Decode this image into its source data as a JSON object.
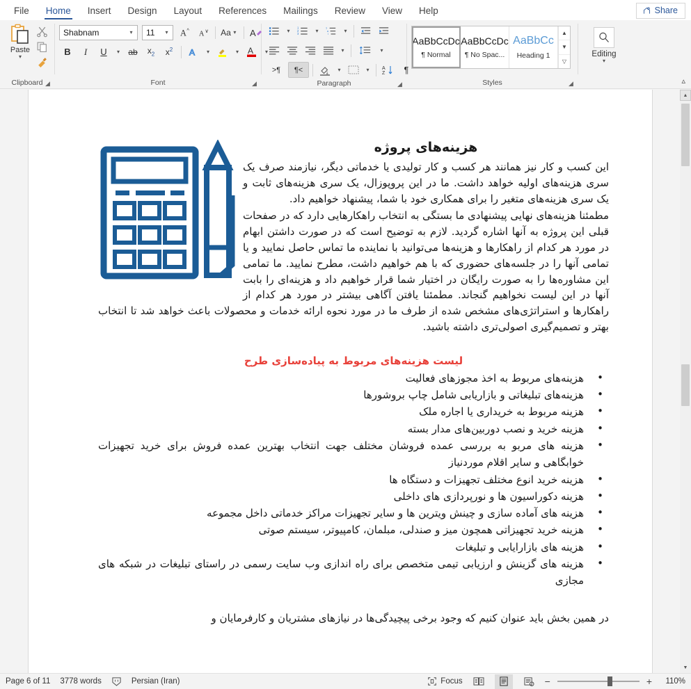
{
  "titlebar": {
    "share_label": "Share",
    "share_icon": "share-person-icon"
  },
  "tabs": [
    {
      "label": "File",
      "active": false
    },
    {
      "label": "Home",
      "active": true
    },
    {
      "label": "Insert",
      "active": false
    },
    {
      "label": "Design",
      "active": false
    },
    {
      "label": "Layout",
      "active": false
    },
    {
      "label": "References",
      "active": false
    },
    {
      "label": "Mailings",
      "active": false
    },
    {
      "label": "Review",
      "active": false
    },
    {
      "label": "View",
      "active": false
    },
    {
      "label": "Help",
      "active": false
    }
  ],
  "ribbon": {
    "clipboard": {
      "group_label": "Clipboard",
      "paste_label": "Paste",
      "paste_icon": "clipboard-paste-icon",
      "cut_icon": "scissors-icon",
      "copy_icon": "copy-icon",
      "format_painter_icon": "format-painter-icon",
      "dialog_launcher_icon": "dialog-launcher-icon"
    },
    "font": {
      "group_label": "Font",
      "font_name": "Shabnam",
      "font_size": "11",
      "grow_font_icon": "grow-font-icon",
      "shrink_font_icon": "shrink-font-icon",
      "change_case_icon": "change-case-icon",
      "clear_formatting_icon": "clear-formatting-icon",
      "bold_label": "B",
      "italic_label": "I",
      "underline_label": "U",
      "strikethrough_icon": "strikethrough-icon",
      "subscript_label": "x",
      "superscript_label": "x",
      "text_effects_icon": "text-effects-icon",
      "highlight_icon": "text-highlight-icon",
      "font_color_icon": "font-color-icon",
      "highlight_color": "#ffff00",
      "font_color": "#e00000",
      "dialog_launcher_icon": "dialog-launcher-icon"
    },
    "paragraph": {
      "group_label": "Paragraph",
      "bullets_icon": "bullets-icon",
      "numbering_icon": "numbering-icon",
      "multilevel_icon": "multilevel-list-icon",
      "decrease_indent_icon": "decrease-indent-icon",
      "increase_indent_icon": "increase-indent-icon",
      "align_left_icon": "align-left-icon",
      "align_center_icon": "align-center-icon",
      "align_right_icon": "align-right-icon",
      "justify_icon": "justify-icon",
      "line_spacing_icon": "line-spacing-icon",
      "ltr_icon": "left-to-right-icon",
      "rtl_icon": "right-to-left-icon",
      "shading_icon": "shading-icon",
      "borders_icon": "borders-icon",
      "sort_icon": "sort-icon",
      "show_marks_icon": "show-formatting-marks-icon",
      "dialog_launcher_icon": "dialog-launcher-icon"
    },
    "styles": {
      "group_label": "Styles",
      "items": [
        {
          "preview": "AaBbCcDc",
          "name": "¶ Normal",
          "selected": true
        },
        {
          "preview": "AaBbCcDc",
          "name": "¶ No Spac...",
          "selected": false
        },
        {
          "preview": "AaBbCc",
          "name": "Heading 1",
          "selected": false
        }
      ],
      "scroll_up_icon": "chevron-up-icon",
      "scroll_down_icon": "chevron-down-icon",
      "more_icon": "styles-more-icon",
      "dialog_launcher_icon": "dialog-launcher-icon"
    },
    "editing": {
      "group_label": "Editing",
      "button_label": "Editing",
      "icon": "magnifier-icon",
      "caret_icon": "chevron-down-icon"
    },
    "collapse_icon": "collapse-ribbon-icon"
  },
  "document": {
    "heading": "هزینه‌های پروژه",
    "paragraph1": "این کسب و کار نیز همانند هر کسب و کار تولیدی یا خدماتی دیگر، نیازمند صرف یک سری هزینه‌های اولیه خواهد داشت. ما در این پروپوزال، یک سری هزینه‌های ثابت و یک سری هزینه‌های متغیر را برای همکاری خود با شما، پیشنهاد خواهیم داد.",
    "paragraph2": "مطمئنا هزینه‌های نهایی پیشنهادی ما بستگی به انتخاب راهکارهایی دارد که در صفحات قبلی این پروژه به آنها اشاره گردید. لازم به توضیح است که در صورت داشتن ابهام در مورد هر کدام از راهکارها و هزینه‌ها می‌توانید با نماینده ما تماس حاصل نمایید و یا تمامی آنها را در جلسه‌های حضوری که با هم خواهیم داشت، مطرح نمایید. ما تمامی این مشاوره‌ها را به صورت رایگان در اختیار شما قرار خواهیم داد و هزینه‌ای را بابت آنها در این لیست نخواهیم گنجاند. مطمئنا یافتن آگاهی بیشتر در مورد هر کدام از راهکارها و استراتژی‌های مشخص شده از طرف ما در مورد نحوه ارائه خدمات و محصولات باعث خواهد شد تا انتخاب بهتر و تصمیم‌گیری اصولی‌تری داشته باشید.",
    "subheading": "لیست هزینه‌های مربوط به پیاده‌سازی طرح",
    "subheading_color": "#e8413a",
    "bullets": [
      "هزینه‌های مربوط به اخذ مجوزهای فعالیت",
      "هزینه‌های تبلیغاتی و بازاریابی شامل چاپ بروشورها",
      "هزینه مربوط به خریداری یا اجاره ملک",
      "هزینه خرید و نصب دوربین‌های مدار بسته",
      "هزینه های مربو به بررسی عمده فروشان مختلف جهت انتخاب بهترین عمده فروش برای خرید تجهیزات خوابگاهی و سایر اقلام موردنیاز",
      "هزینه خرید انوع مختلف تجهیزات و دستگاه ها",
      "هزینه دکوراسیون ها و نورپردازی های داخلی",
      "هزینه های آماده سازی و چینش ویترین ها و سایر تجهیزات مراکز خدماتی داخل مجموعه",
      "هزینه خرید تجهیزاتی همچون میز و صندلی، مبلمان، کامپیوتر، سیستم صوتی",
      "هزینه های بازارایابی و تبلیغات",
      "هزینه های گزینش و ارزیابی تیمی متخصص برای راه اندازی وب سایت رسمی در راستای تبلیغات در شبکه های مجازی"
    ],
    "tail_paragraph": "در همین بخش باید عنوان کنیم که وجود برخی پیچیدگی‌ها در نیازهای مشتریان و کارفرمایان و",
    "image": {
      "name": "calculator-pencil-illustration",
      "color": "#1b5c96"
    }
  },
  "statusbar": {
    "page_info": "Page 6 of 11",
    "word_count": "3778 words",
    "proofing_icon": "proofing-errors-icon",
    "language": "Persian (Iran)",
    "focus_label": "Focus",
    "focus_icon": "focus-mode-icon",
    "read_mode_icon": "read-mode-icon",
    "print_layout_icon": "print-layout-icon",
    "web_layout_icon": "web-layout-icon",
    "zoom_out_icon": "zoom-out-icon",
    "zoom_in_icon": "zoom-in-icon",
    "zoom_level": "110%"
  }
}
